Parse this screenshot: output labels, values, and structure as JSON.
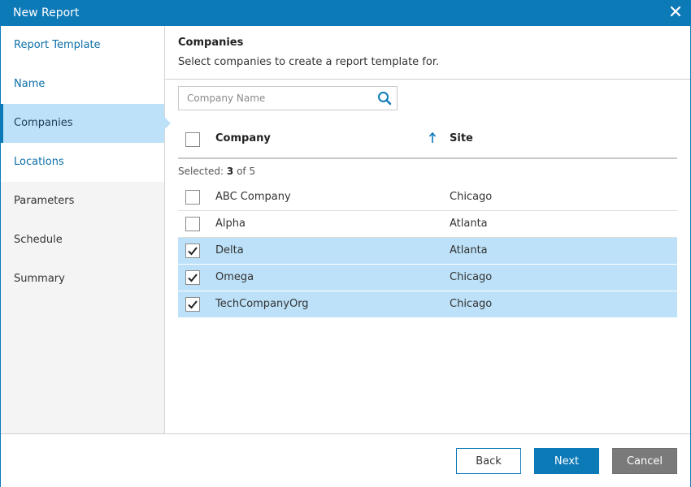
{
  "window": {
    "title": "New Report"
  },
  "sidebar": {
    "items": [
      {
        "label": "Report Template",
        "state": "done"
      },
      {
        "label": "Name",
        "state": "done"
      },
      {
        "label": "Companies",
        "state": "active"
      },
      {
        "label": "Locations",
        "state": "done"
      },
      {
        "label": "Parameters",
        "state": "pending"
      },
      {
        "label": "Schedule",
        "state": "pending"
      },
      {
        "label": "Summary",
        "state": "pending"
      }
    ]
  },
  "main": {
    "title": "Companies",
    "subtitle": "Select companies to create a report template for.",
    "search": {
      "placeholder": "Company Name",
      "value": ""
    },
    "table": {
      "columns": {
        "company": "Company",
        "site": "Site"
      },
      "sort": {
        "column": "company",
        "direction": "ascending"
      },
      "selected_prefix": "Selected: ",
      "selected_count": "3",
      "selected_of": " of 5",
      "rows": [
        {
          "company": "ABC Company",
          "site": "Chicago",
          "checked": false
        },
        {
          "company": "Alpha",
          "site": "Atlanta",
          "checked": false
        },
        {
          "company": "Delta",
          "site": "Atlanta",
          "checked": true
        },
        {
          "company": "Omega",
          "site": "Chicago",
          "checked": true
        },
        {
          "company": "TechCompanyOrg",
          "site": "Chicago",
          "checked": true
        }
      ]
    }
  },
  "footer": {
    "back_label": "Back",
    "next_label": "Next",
    "cancel_label": "Cancel"
  },
  "colors": {
    "accent": "#0d7ab8",
    "selection": "#bde1f8",
    "cancel": "#7a7a7a"
  },
  "icons": {
    "close": "close-icon",
    "search": "search-icon",
    "sort": "sort-ascending-icon",
    "check": "checkmark-icon"
  }
}
